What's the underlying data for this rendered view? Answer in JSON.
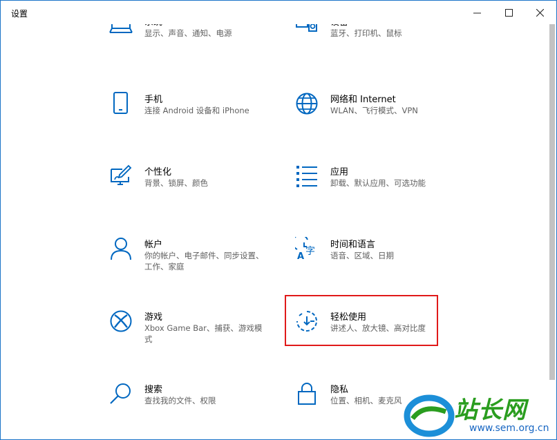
{
  "window": {
    "title": "设置"
  },
  "items": [
    {
      "title": "系统",
      "desc": "显示、声音、通知、电源",
      "icon": "laptop-icon"
    },
    {
      "title": "设备",
      "desc": "蓝牙、打印机、鼠标",
      "icon": "devices-icon"
    },
    {
      "title": "手机",
      "desc": "连接 Android 设备和 iPhone",
      "icon": "phone-icon"
    },
    {
      "title": "网络和 Internet",
      "desc": "WLAN、飞行模式、VPN",
      "icon": "globe-icon"
    },
    {
      "title": "个性化",
      "desc": "背景、锁屏、颜色",
      "icon": "personalization-icon"
    },
    {
      "title": "应用",
      "desc": "卸载、默认应用、可选功能",
      "icon": "apps-icon"
    },
    {
      "title": "帐户",
      "desc": "你的帐户、电子邮件、同步设置、工作、家庭",
      "icon": "person-icon"
    },
    {
      "title": "时间和语言",
      "desc": "语音、区域、日期",
      "icon": "time-language-icon"
    },
    {
      "title": "游戏",
      "desc": "Xbox Game Bar、捕获、游戏模式",
      "icon": "xbox-icon"
    },
    {
      "title": "轻松使用",
      "desc": "讲述人、放大镜、高对比度",
      "icon": "ease-of-access-icon"
    },
    {
      "title": "搜索",
      "desc": "查找我的文件、权限",
      "icon": "search-icon"
    },
    {
      "title": "隐私",
      "desc": "位置、相机、麦克风",
      "icon": "lock-icon"
    }
  ],
  "watermark": {
    "text": "站长网",
    "url": "www.sem.org.cn"
  },
  "colors": {
    "accent": "#0067c0",
    "highlight": "#e01919"
  }
}
